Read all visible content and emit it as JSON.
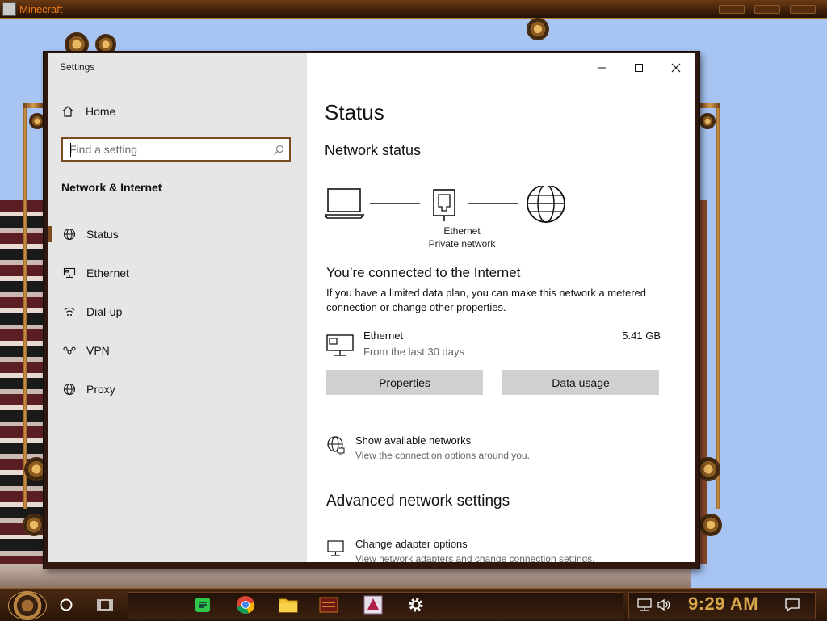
{
  "background_app": {
    "title": "Minecraft"
  },
  "window": {
    "title": "Settings",
    "controls": {
      "minimize_glyph": "—",
      "maximize_glyph": "☐",
      "close_glyph": "✕"
    }
  },
  "sidebar": {
    "home_label": "Home",
    "search_placeholder": "Find a setting",
    "section_title": "Network & Internet",
    "items": [
      {
        "label": "Status",
        "icon": "globe-status-icon",
        "active": true
      },
      {
        "label": "Ethernet",
        "icon": "ethernet-icon",
        "active": false
      },
      {
        "label": "Dial-up",
        "icon": "dialup-icon",
        "active": false
      },
      {
        "label": "VPN",
        "icon": "vpn-icon",
        "active": false
      },
      {
        "label": "Proxy",
        "icon": "globe-icon",
        "active": false
      }
    ]
  },
  "main": {
    "title": "Status",
    "network_status_heading": "Network status",
    "diagram": {
      "adapter_name": "Ethernet",
      "network_type": "Private network"
    },
    "connected_heading": "You’re connected to the Internet",
    "description": "If you have a limited data plan, you can make this network a metered connection or change other properties.",
    "connection": {
      "name": "Ethernet",
      "period": "From the last 30 days",
      "usage": "5.41 GB"
    },
    "buttons": {
      "properties": "Properties",
      "data_usage": "Data usage"
    },
    "show_networks": {
      "title": "Show available networks",
      "subtitle": "View the connection options around you."
    },
    "advanced_heading": "Advanced network settings",
    "adapter_options": {
      "title": "Change adapter options",
      "subtitle": "View network adapters and change connection settings."
    }
  },
  "taskbar": {
    "clock": "9:29 AM",
    "accent_color": "#d7a54a"
  },
  "colors": {
    "sidebar_bg": "#e6e6e6",
    "content_bg": "#ffffff",
    "accent": "#7a4a20",
    "button_bg": "#d0d0d0"
  }
}
